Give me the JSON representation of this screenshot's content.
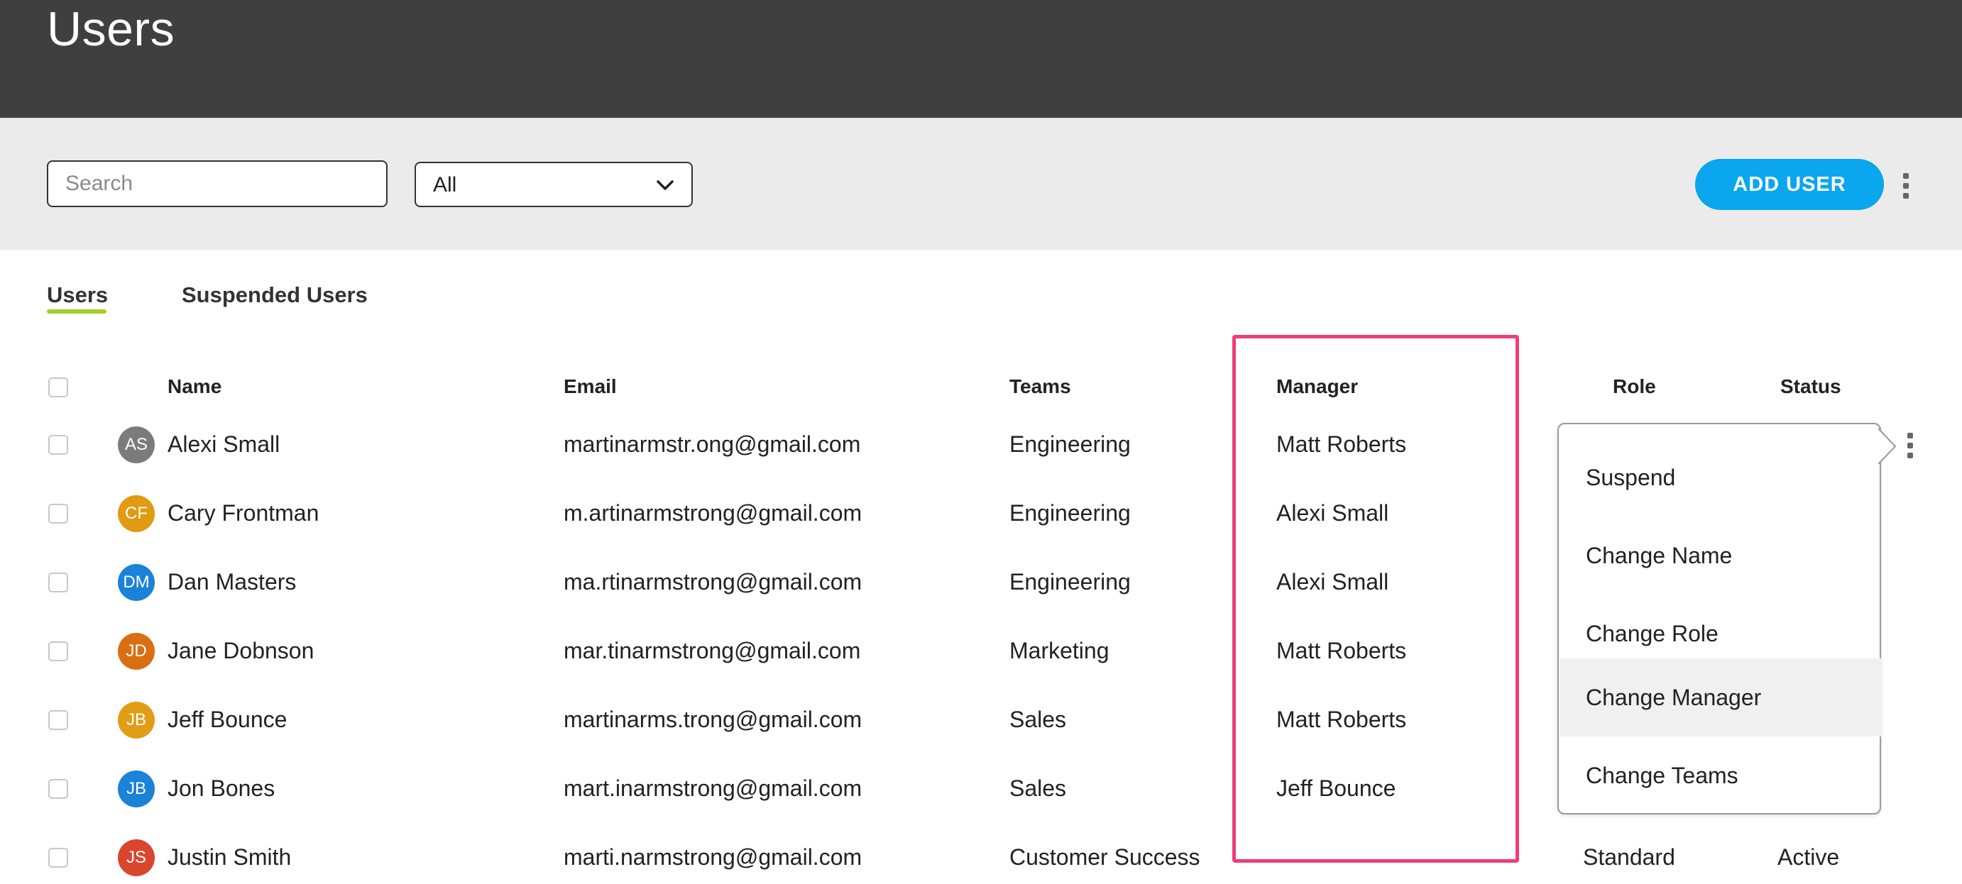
{
  "header": {
    "title": "Users"
  },
  "toolbar": {
    "search_placeholder": "Search",
    "filter_value": "All",
    "add_user_label": "ADD USER"
  },
  "tabs": [
    {
      "label": "Users",
      "active": true
    },
    {
      "label": "Suspended Users",
      "active": false
    }
  ],
  "table": {
    "columns": [
      "Name",
      "Email",
      "Teams",
      "Manager",
      "Role",
      "Status"
    ],
    "rows": [
      {
        "initials": "AS",
        "avatar_color": "#7b7b7b",
        "name": "Alexi Small",
        "email": "martinarmstr.ong@gmail.com",
        "team": "Engineering",
        "manager": "Matt Roberts",
        "role": "",
        "status": ""
      },
      {
        "initials": "CF",
        "avatar_color": "#e19a12",
        "name": "Cary Frontman",
        "email": "m.artinarmstrong@gmail.com",
        "team": "Engineering",
        "manager": "Alexi Small",
        "role": "",
        "status": ""
      },
      {
        "initials": "DM",
        "avatar_color": "#1a82d8",
        "name": "Dan Masters",
        "email": "ma.rtinarmstrong@gmail.com",
        "team": "Engineering",
        "manager": "Alexi Small",
        "role": "",
        "status": ""
      },
      {
        "initials": "JD",
        "avatar_color": "#d96f12",
        "name": "Jane Dobnson",
        "email": "mar.tinarmstrong@gmail.com",
        "team": "Marketing",
        "manager": "Matt Roberts",
        "role": "",
        "status": ""
      },
      {
        "initials": "JB",
        "avatar_color": "#e29d16",
        "name": "Jeff Bounce",
        "email": "martinarms.trong@gmail.com",
        "team": "Sales",
        "manager": "Matt Roberts",
        "role": "",
        "status": ""
      },
      {
        "initials": "JB",
        "avatar_color": "#1a82d8",
        "name": "Jon Bones",
        "email": "mart.inarmstrong@gmail.com",
        "team": "Sales",
        "manager": "Jeff Bounce",
        "role": "",
        "status": ""
      },
      {
        "initials": "JS",
        "avatar_color": "#d9462d",
        "name": "Justin Smith",
        "email": "marti.narmstrong@gmail.com",
        "team": "Customer Success",
        "manager": "",
        "role": "Standard",
        "status": "Active"
      }
    ]
  },
  "context_menu": {
    "items": [
      {
        "label": "Suspend",
        "active": false
      },
      {
        "label": "Change Name",
        "active": false
      },
      {
        "label": "Change Role",
        "active": false
      },
      {
        "label": "Change Manager",
        "active": true
      },
      {
        "label": "Change Teams",
        "active": false
      }
    ]
  },
  "colors": {
    "header_bg": "#3f3f3f",
    "toolbar_bg": "#ebebeb",
    "accent_blue": "#0aa6ee",
    "tab_underline": "#a8cc2e",
    "highlight_border": "#ee3d77"
  },
  "icons": [
    "chevron-down-icon",
    "more-vertical-icon"
  ]
}
